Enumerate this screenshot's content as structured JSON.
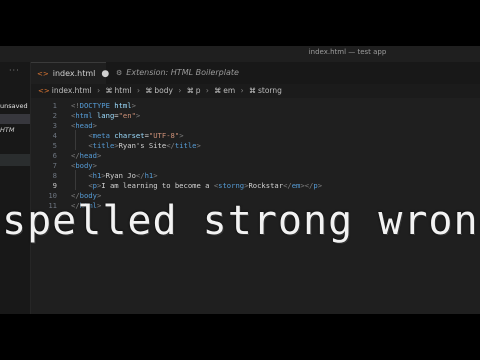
{
  "window": {
    "title": "index.html — test app"
  },
  "sidebar": {
    "dots": "···",
    "unsaved_label": "unsaved",
    "item_html": "HTM"
  },
  "tabs": [
    {
      "label": "index.html",
      "icon": "html-file-icon",
      "modified": "●"
    },
    {
      "label": "Extension: HTML Boilerplate",
      "icon": "extension-icon"
    }
  ],
  "breadcrumb": [
    "index.html",
    "html",
    "body",
    "p",
    "em",
    "storng"
  ],
  "editor": {
    "line_numbers": [
      "1",
      "2",
      "3",
      "4",
      "5",
      "6",
      "7",
      "8",
      "9",
      "10",
      "11"
    ],
    "lines": [
      [
        [
          "br",
          "<!"
        ],
        [
          "t",
          "DOCTYPE"
        ],
        [
          "tx",
          " "
        ],
        [
          "a",
          "html"
        ],
        [
          "br",
          ">"
        ]
      ],
      [
        [
          "br",
          "<"
        ],
        [
          "t",
          "html"
        ],
        [
          "tx",
          " "
        ],
        [
          "a",
          "lang"
        ],
        [
          "tx",
          "="
        ],
        [
          "s",
          "\"en\""
        ],
        [
          "br",
          ">"
        ]
      ],
      [
        [
          "br",
          "<"
        ],
        [
          "t",
          "head"
        ],
        [
          "br",
          ">"
        ]
      ],
      [
        [
          "tx",
          "    "
        ],
        [
          "br",
          "<"
        ],
        [
          "t",
          "meta"
        ],
        [
          "tx",
          " "
        ],
        [
          "a",
          "charset"
        ],
        [
          "tx",
          "="
        ],
        [
          "s",
          "\"UTF-8\""
        ],
        [
          "br",
          ">"
        ]
      ],
      [
        [
          "tx",
          "    "
        ],
        [
          "br",
          "<"
        ],
        [
          "t",
          "title"
        ],
        [
          "br",
          ">"
        ],
        [
          "tx",
          "Ryan's Site"
        ],
        [
          "br",
          "</"
        ],
        [
          "t",
          "title"
        ],
        [
          "br",
          ">"
        ]
      ],
      [
        [
          "br",
          "</"
        ],
        [
          "t",
          "head"
        ],
        [
          "br",
          ">"
        ]
      ],
      [
        [
          "br",
          "<"
        ],
        [
          "t",
          "body"
        ],
        [
          "br",
          ">"
        ]
      ],
      [
        [
          "tx",
          "    "
        ],
        [
          "br",
          "<"
        ],
        [
          "t",
          "h1"
        ],
        [
          "br",
          ">"
        ],
        [
          "tx",
          "Ryan Jo"
        ],
        [
          "br",
          "</"
        ],
        [
          "t",
          "h1"
        ],
        [
          "br",
          ">"
        ]
      ],
      [
        [
          "tx",
          "    "
        ],
        [
          "br",
          "<"
        ],
        [
          "t",
          "p"
        ],
        [
          "br",
          ">"
        ],
        [
          "tx",
          "I am learning to become a "
        ],
        [
          "br",
          "<"
        ],
        [
          "t",
          "storng"
        ],
        [
          "br",
          ">"
        ],
        [
          "tx",
          "Rockstar"
        ],
        [
          "br",
          "</"
        ],
        [
          "t",
          "em"
        ],
        [
          "br",
          "></"
        ],
        [
          "t",
          "p"
        ],
        [
          "br",
          ">"
        ]
      ],
      [
        [
          "br",
          "</"
        ],
        [
          "t",
          "body"
        ],
        [
          "br",
          ">"
        ]
      ],
      [
        [
          "br",
          "</"
        ],
        [
          "t",
          "html"
        ],
        [
          "br",
          ">"
        ]
      ]
    ]
  },
  "overlay_caption": "spelled strong wrong :"
}
